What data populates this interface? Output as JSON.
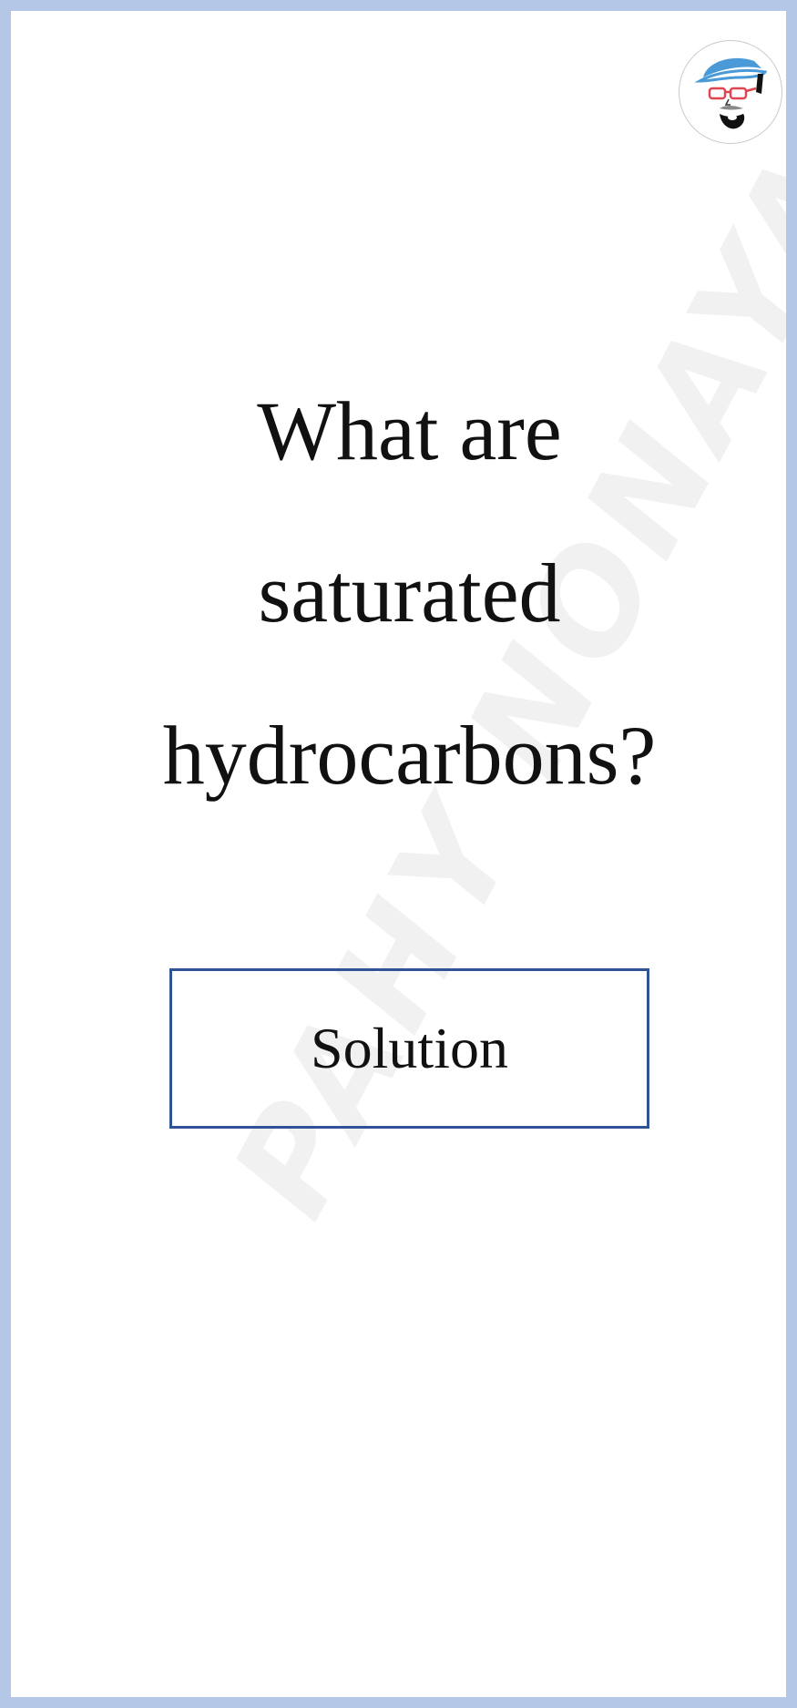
{
  "question": {
    "lines": [
      "What are",
      "saturated",
      "hydrocarbons?"
    ]
  },
  "solution_button": {
    "label": "Solution"
  },
  "watermark": {
    "text": "PAHY NONAYA"
  },
  "avatar": {
    "icon": "cartoon-face-with-cap-and-glasses"
  },
  "colors": {
    "frame": "#b4c7e7",
    "button_border": "#2f5496",
    "text": "#111111",
    "watermark": "#f1f1f1"
  }
}
